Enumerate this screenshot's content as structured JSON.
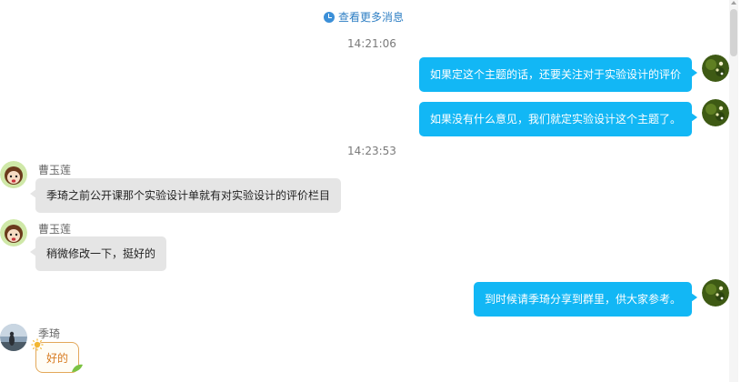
{
  "header": {
    "more_messages_label": "查看更多消息",
    "icon": "clock-icon"
  },
  "timestamps": [
    "14:21:06",
    "14:23:53"
  ],
  "messages": [
    {
      "direction": "out",
      "text": "如果定这个主题的话，还要关注对于实验设计的评价"
    },
    {
      "direction": "out",
      "text": "如果没有什么意见，我们就定实验设计这个主题了。"
    },
    {
      "direction": "in",
      "sender": "曹玉莲",
      "text": "季琦之前公开课那个实验设计单就有对实验设计的评价栏目"
    },
    {
      "direction": "in",
      "sender": "曹玉莲",
      "text": "稍微修改一下，挺好的"
    },
    {
      "direction": "out",
      "text": "到时候请季琦分享到群里，供大家参考。"
    },
    {
      "direction": "in",
      "sender": "季琦",
      "text": "好的"
    }
  ],
  "colors": {
    "outgoing_bubble": "#12b7f5",
    "incoming_bubble": "#e5e5e5",
    "link": "#2f7fc4",
    "sticker_border": "#e3a85a"
  }
}
